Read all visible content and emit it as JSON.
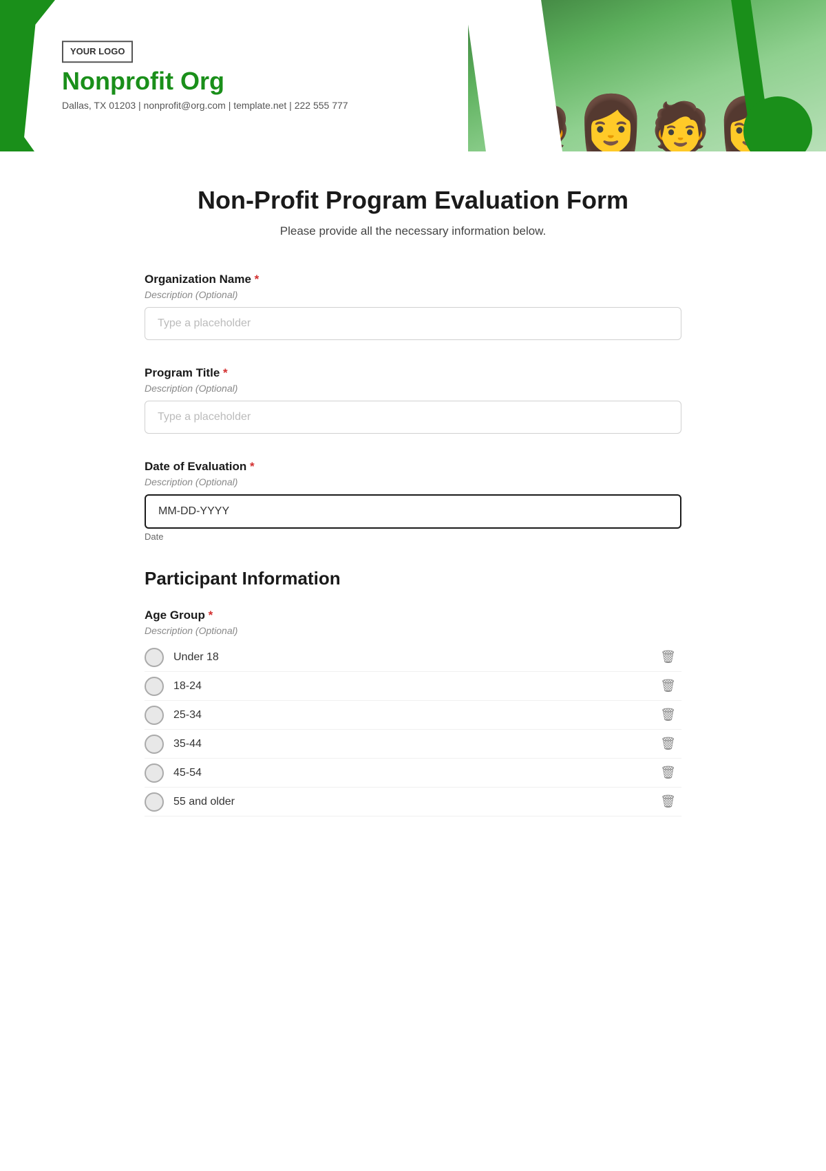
{
  "header": {
    "logo_text": "YOUR\nLOGO",
    "org_name": "Nonprofit Org",
    "contact": "Dallas, TX 01203 | nonprofit@org.com | template.net | 222 555 777"
  },
  "form": {
    "title": "Non-Profit Program Evaluation Form",
    "subtitle": "Please provide all the necessary information below.",
    "fields": [
      {
        "label": "Organization Name",
        "required": true,
        "description": "Description (Optional)",
        "type": "text",
        "placeholder": "Type a placeholder"
      },
      {
        "label": "Program Title",
        "required": true,
        "description": "Description (Optional)",
        "type": "text",
        "placeholder": "Type a placeholder"
      },
      {
        "label": "Date of Evaluation",
        "required": true,
        "description": "Description (Optional)",
        "type": "date",
        "placeholder": "MM-DD-YYYY",
        "helper": "Date"
      }
    ],
    "sections": [
      {
        "title": "Participant Information",
        "fields": [
          {
            "label": "Age Group",
            "required": true,
            "description": "Description (Optional)",
            "type": "radio",
            "options": [
              "Under 18",
              "18-24",
              "25-34",
              "35-44",
              "45-54",
              "55 and older"
            ]
          }
        ]
      }
    ]
  }
}
